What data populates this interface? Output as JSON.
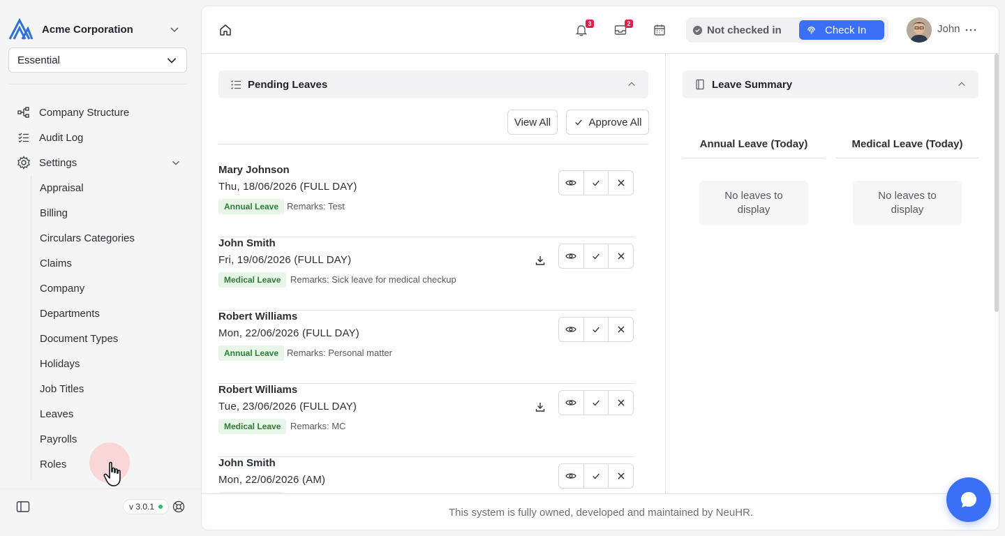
{
  "brand": {
    "name": "Acme Corporation",
    "logo_icon": "acme-logo"
  },
  "plan": {
    "selected": "Essential"
  },
  "nav": {
    "items": [
      {
        "label": "Company Structure",
        "icon": "org-chart-icon"
      },
      {
        "label": "Audit Log",
        "icon": "checklist-icon"
      },
      {
        "label": "Settings",
        "icon": "gear-icon"
      }
    ],
    "settings_sub": [
      "Appraisal",
      "Billing",
      "Circulars Categories",
      "Claims",
      "Company",
      "Departments",
      "Document Types",
      "Holidays",
      "Job Titles",
      "Leaves",
      "Payrolls",
      "Roles"
    ]
  },
  "sidebar_footer": {
    "version": "v 3.0.1"
  },
  "topbar": {
    "notifications_count": "3",
    "inbox_count": "2",
    "status_text": "Not checked in",
    "checkin_label": "Check In",
    "user_name": "John"
  },
  "pending": {
    "title": "Pending Leaves",
    "view_all": "View All",
    "approve_all": "Approve All",
    "items": [
      {
        "name": "Mary Johnson",
        "date": "Thu, 18/06/2026 (FULL DAY)",
        "type": "Annual Leave",
        "remarks": "Remarks: Test",
        "has_download": false
      },
      {
        "name": "John Smith",
        "date": "Fri, 19/06/2026 (FULL DAY)",
        "type": "Medical Leave",
        "remarks": "Remarks: Sick leave for medical checkup",
        "has_download": true
      },
      {
        "name": "Robert Williams",
        "date": "Mon, 22/06/2026 (FULL DAY)",
        "type": "Annual Leave",
        "remarks": "Remarks: Personal matter",
        "has_download": false
      },
      {
        "name": "Robert Williams",
        "date": "Tue, 23/06/2026 (FULL DAY)",
        "type": "Medical Leave",
        "remarks": "Remarks: MC",
        "has_download": true
      },
      {
        "name": "John Smith",
        "date": "Mon, 22/06/2026 (AM)",
        "type": "",
        "remarks": "",
        "has_download": false
      }
    ]
  },
  "summary": {
    "title": "Leave Summary",
    "columns": [
      {
        "header": "Annual Leave (Today)",
        "empty": "No leaves to display"
      },
      {
        "header": "Medical Leave (Today)",
        "empty": "No leaves to display"
      }
    ]
  },
  "footer": {
    "text": "This system is fully owned, developed and maintained by NeuHR."
  },
  "colors": {
    "accent": "#3b6ff5",
    "badge": "#e11d48",
    "leave_tag_bg": "#e8f5e9",
    "leave_tag_fg": "#2e7d32"
  }
}
